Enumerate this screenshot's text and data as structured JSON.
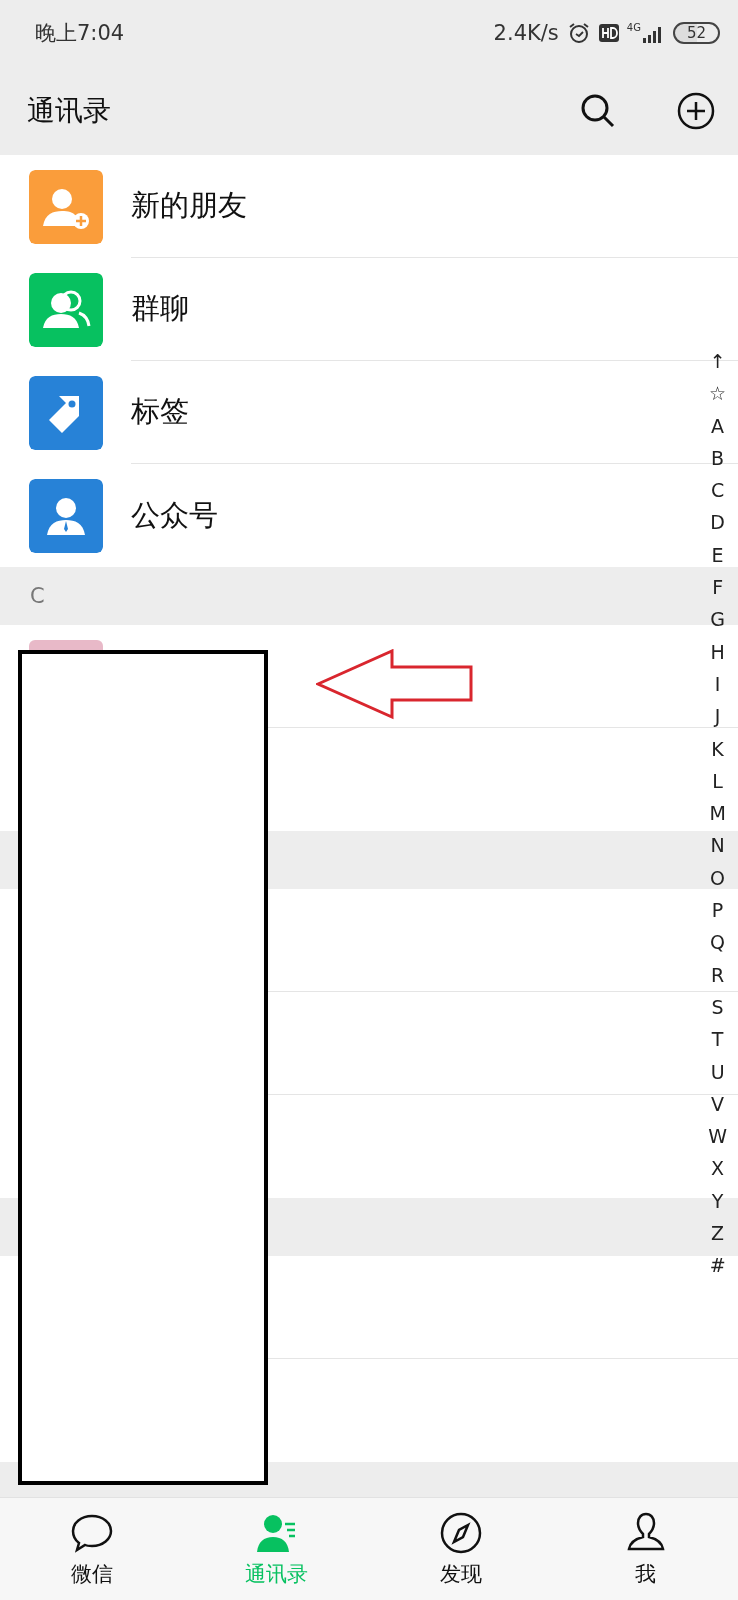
{
  "status_bar": {
    "time": "晚上7:04",
    "speed": "2.4K/s",
    "network": "4G",
    "battery": "52"
  },
  "header": {
    "title": "通讯录"
  },
  "entries": [
    {
      "kind": "new_friends",
      "label": "新的朋友"
    },
    {
      "kind": "group_chats",
      "label": "群聊"
    },
    {
      "kind": "tags",
      "label": "标签"
    },
    {
      "kind": "official_accounts",
      "label": "公众号"
    }
  ],
  "contact_sections": [
    {
      "letter": "C",
      "rows": [
        {
          "kind": "avatar"
        },
        {
          "kind": "hidden"
        }
      ]
    },
    {
      "rows": [
        {
          "kind": "hidden"
        },
        {
          "kind": "hidden"
        },
        {
          "kind": "hidden"
        }
      ]
    },
    {
      "rows": [
        {
          "kind": "hidden"
        },
        {
          "kind": "hidden"
        }
      ]
    }
  ],
  "index_bar": [
    "↑",
    "☆",
    "A",
    "B",
    "C",
    "D",
    "E",
    "F",
    "G",
    "H",
    "I",
    "J",
    "K",
    "L",
    "M",
    "N",
    "O",
    "P",
    "Q",
    "R",
    "S",
    "T",
    "U",
    "V",
    "W",
    "X",
    "Y",
    "Z",
    "#"
  ],
  "tabs": [
    {
      "kind": "chats",
      "label": "微信",
      "selected": false
    },
    {
      "kind": "contacts",
      "label": "通讯录",
      "selected": true
    },
    {
      "kind": "discover",
      "label": "发现",
      "selected": false
    },
    {
      "kind": "me",
      "label": "我",
      "selected": false
    }
  ],
  "annotations": {
    "redaction": true,
    "arrow": true
  }
}
